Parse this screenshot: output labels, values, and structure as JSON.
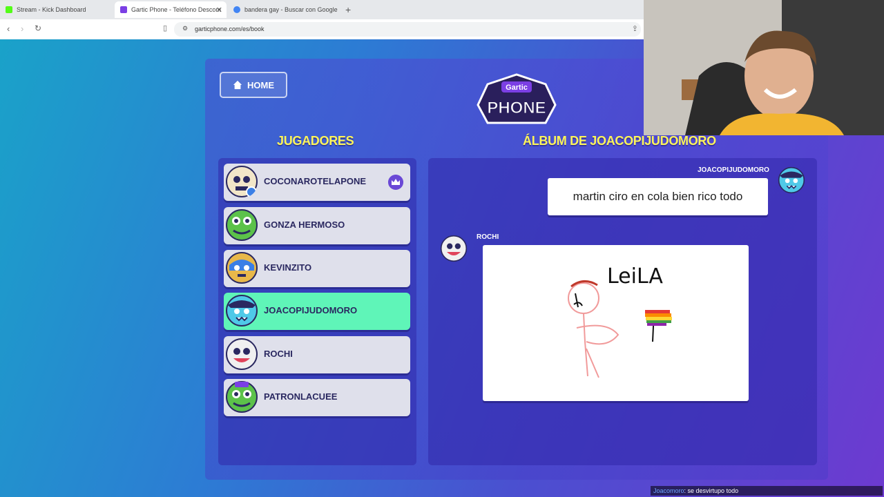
{
  "browser": {
    "tabs": [
      {
        "title": "Stream - Kick Dashboard",
        "favicon_color": "#53fc18"
      },
      {
        "title": "Gartic Phone - Teléfono Descom",
        "favicon_color": "#7b3fe4"
      },
      {
        "title": "bandera gay - Buscar con Google",
        "favicon_color": "#4285f4"
      }
    ],
    "url": "garticphone.com/es/book"
  },
  "page": {
    "home_label": "HOME",
    "logo_top": "Gartic",
    "logo_bottom": "PHONE",
    "players_heading": "JUGADORES",
    "album_heading": "ÁLBUM DE JOACOPIJUDOMORO"
  },
  "players": [
    {
      "name": "COCONAROTELAPONE",
      "host": true,
      "active": false,
      "avatar_color": "#f2e6c8"
    },
    {
      "name": "GONZA HERMOSO",
      "host": false,
      "active": false,
      "avatar_color": "#5cc24a"
    },
    {
      "name": "KEVINZITO",
      "host": false,
      "active": false,
      "avatar_color": "#e8b84a"
    },
    {
      "name": "JOACOPIJUDOMORO",
      "host": false,
      "active": true,
      "avatar_color": "#4fc9e8"
    },
    {
      "name": "ROCHI",
      "host": false,
      "active": false,
      "avatar_color": "#f0f0f0"
    },
    {
      "name": "PATRONLACUEE",
      "host": false,
      "active": false,
      "avatar_color": "#5cc24a"
    }
  ],
  "album": {
    "entry1": {
      "author": "JOACOPIJUDOMORO",
      "text": "martin ciro en cola bien rico todo"
    },
    "entry2": {
      "author": "ROCHI",
      "drawing_text": "LeiLA"
    }
  },
  "chat": {
    "user": "Joacomoro",
    "message": ": se desvirtupo todo"
  },
  "colors": {
    "accent_green": "#5ff5b8",
    "heading_yellow": "#fcf45a"
  }
}
